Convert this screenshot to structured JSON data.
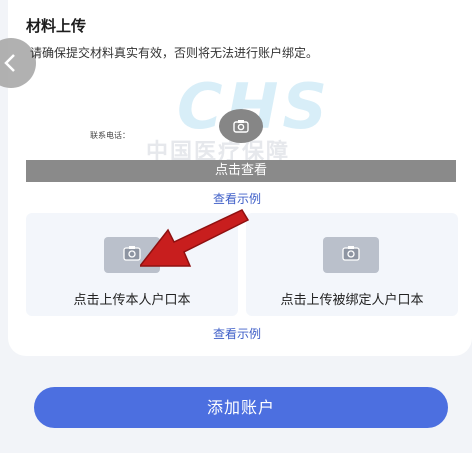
{
  "section": {
    "title": "材料上传",
    "notice": "请确保提交材料真实有效，否则将无法进行账户绑定。"
  },
  "upload_main": {
    "watermark_logo": "CHS",
    "watermark_text": "中国医疗保障",
    "contact_label": "联系电话：",
    "icon": "camera-icon",
    "view_label": "点击查看"
  },
  "example_link_1": "查看示例",
  "household": {
    "self_label": "点击上传本人户口本",
    "bound_label": "点击上传被绑定人户口本",
    "icon": "camera-icon"
  },
  "example_link_2": "查看示例",
  "add_button": "添加账户",
  "colors": {
    "primary": "#4c6fe0",
    "link": "#3f5fc8",
    "arrow": "#c81e1e"
  }
}
